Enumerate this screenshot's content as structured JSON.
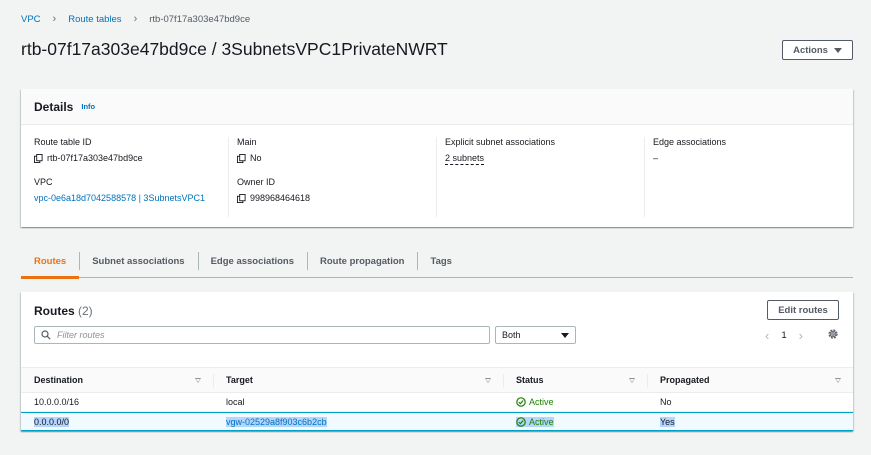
{
  "breadcrumb": {
    "items": [
      "VPC",
      "Route tables"
    ],
    "current": "rtb-07f17a303e47bd9ce"
  },
  "header": {
    "title": "rtb-07f17a303e47bd9ce / 3SubnetsVPC1PrivateNWRT",
    "actions_label": "Actions"
  },
  "details": {
    "title": "Details",
    "info_label": "Info",
    "route_table_id_label": "Route table ID",
    "route_table_id": "rtb-07f17a303e47bd9ce",
    "vpc_label": "VPC",
    "vpc_value": "vpc-0e6a18d7042588578 | 3SubnetsVPC1",
    "main_label": "Main",
    "main_value": "No",
    "owner_label": "Owner ID",
    "owner_value": "998968464618",
    "explicit_label": "Explicit subnet associations",
    "explicit_value": "2 subnets",
    "edge_label": "Edge associations",
    "edge_value": "–"
  },
  "tabs": [
    {
      "label": "Routes",
      "active": true
    },
    {
      "label": "Subnet associations",
      "active": false
    },
    {
      "label": "Edge associations",
      "active": false
    },
    {
      "label": "Route propagation",
      "active": false
    },
    {
      "label": "Tags",
      "active": false
    }
  ],
  "routes": {
    "title": "Routes",
    "count": "(2)",
    "edit_label": "Edit routes",
    "filter_placeholder": "Filter routes",
    "select_value": "Both",
    "page": "1",
    "columns": [
      "Destination",
      "Target",
      "Status",
      "Propagated"
    ],
    "rows": [
      {
        "destination": "10.0.0.0/16",
        "target": "local",
        "status": "Active",
        "propagated": "No"
      },
      {
        "destination": "0.0.0.0/0",
        "target": "vgw-02529a8f903c6b2cb",
        "status": "Active",
        "propagated": "Yes"
      }
    ]
  },
  "colors": {
    "link": "#0073bb",
    "active_tab": "#ec7211",
    "status_active": "#1d8102",
    "selection": "#b4d5fe"
  }
}
